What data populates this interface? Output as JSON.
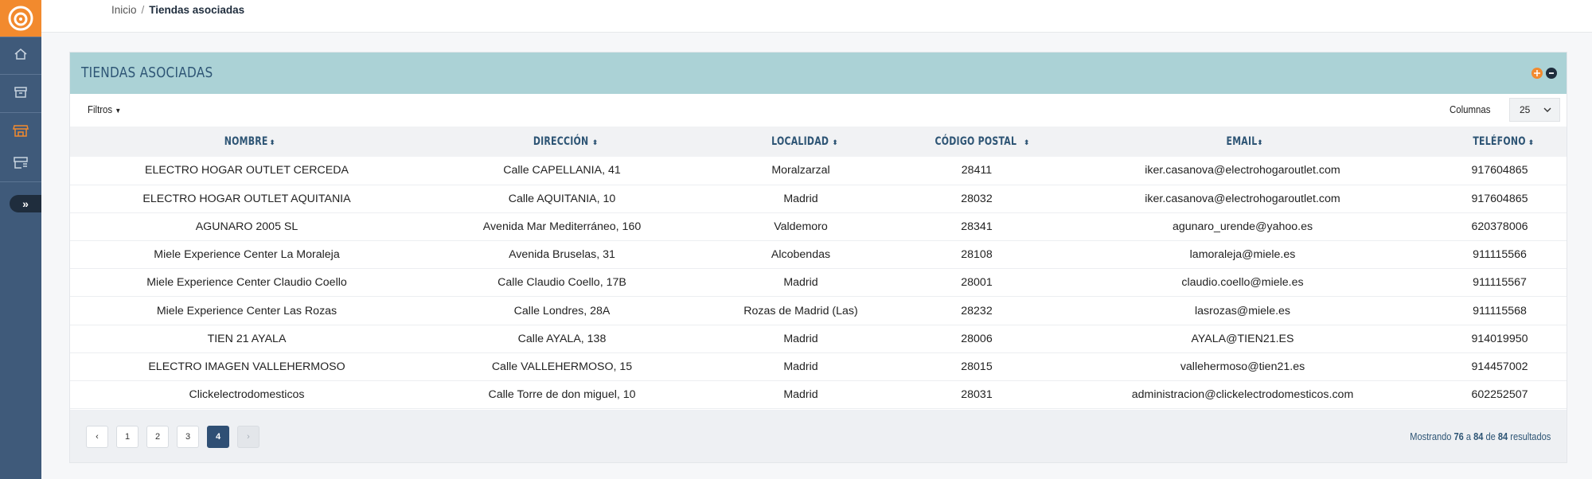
{
  "breadcrumb": {
    "home": "Inicio",
    "separator": "/",
    "current": "Tiendas asociadas"
  },
  "sidebar": {
    "icons": [
      "home-icon",
      "archive-icon",
      "store-icon",
      "store-list-icon"
    ],
    "expand_label": "»"
  },
  "card": {
    "title": "TIENDAS ASOCIADAS",
    "filters_label": "Filtros",
    "columns_label": "Columnas",
    "page_size": "25"
  },
  "table": {
    "headers": [
      "NOMBRE",
      "DIRECCIÓN",
      "LOCALIDAD",
      "CÓDIGO POSTAL",
      "EMAIL",
      "TELÉFONO"
    ],
    "rows": [
      [
        "ELECTRO HOGAR OUTLET CERCEDA",
        "Calle CAPELLANIA, 41",
        "Moralzarzal",
        "28411",
        "iker.casanova@electrohogaroutlet.com",
        "917604865"
      ],
      [
        "ELECTRO HOGAR OUTLET AQUITANIA",
        "Calle AQUITANIA, 10",
        "Madrid",
        "28032",
        "iker.casanova@electrohogaroutlet.com",
        "917604865"
      ],
      [
        "AGUNARO 2005 SL",
        "Avenida Mar Mediterráneo, 160",
        "Valdemoro",
        "28341",
        "agunaro_urende@yahoo.es",
        "620378006"
      ],
      [
        "Miele Experience Center La Moraleja",
        "Avenida Bruselas, 31",
        "Alcobendas",
        "28108",
        "lamoraleja@miele.es",
        "911115566"
      ],
      [
        "Miele Experience Center Claudio Coello",
        "Calle Claudio Coello, 17B",
        "Madrid",
        "28001",
        "claudio.coello@miele.es",
        "911115567"
      ],
      [
        "Miele Experience Center Las Rozas",
        "Calle Londres, 28A",
        "Rozas de Madrid (Las)",
        "28232",
        "lasrozas@miele.es",
        "911115568"
      ],
      [
        "TIEN 21 AYALA",
        "Calle AYALA, 138",
        "Madrid",
        "28006",
        "AYALA@TIEN21.ES",
        "914019950"
      ],
      [
        "ELECTRO IMAGEN VALLEHERMOSO",
        "Calle VALLEHERMOSO, 15",
        "Madrid",
        "28015",
        "vallehermoso@tien21.es",
        "914457002"
      ],
      [
        "Clickelectrodomesticos",
        "Calle Torre de don miguel, 10",
        "Madrid",
        "28031",
        "administracion@clickelectrodomesticos.com",
        "602252507"
      ]
    ]
  },
  "pagination": {
    "prev": "‹",
    "pages": [
      "1",
      "2",
      "3",
      "4"
    ],
    "current": "4",
    "next": "›"
  },
  "summary": {
    "prefix": "Mostrando",
    "from": "76",
    "to_word": "a",
    "to": "84",
    "of_word": "de",
    "total": "84",
    "suffix": "resultados"
  },
  "colors": {
    "sidebar": "#3f5a7a",
    "logo": "#f28a2e",
    "header": "#abd2d6",
    "title": "#2e5575",
    "active_page": "#2f4f74"
  }
}
